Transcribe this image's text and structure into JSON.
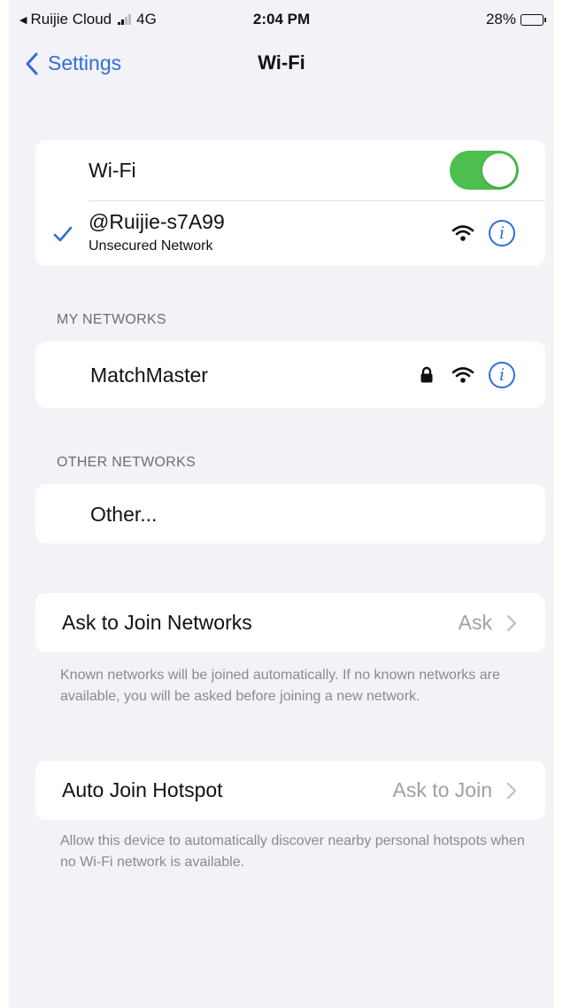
{
  "status_bar": {
    "back_app": "Ruijie Cloud",
    "network_type": "4G",
    "time": "2:04 PM",
    "battery_percent": "28%",
    "battery_level": 0.28,
    "signal_bars": 2
  },
  "nav": {
    "back_label": "Settings",
    "title": "Wi-Fi"
  },
  "wifi_group": {
    "toggle_label": "Wi-Fi",
    "toggle_on": true,
    "connected_network": {
      "name": "@Ruijie-s7A99",
      "status": "Unsecured Network",
      "icons": [
        "checkmark-icon",
        "wifi-icon",
        "info-icon"
      ]
    }
  },
  "my_networks": {
    "header": "MY NETWORKS",
    "items": [
      {
        "name": "MatchMaster",
        "locked": true
      }
    ]
  },
  "other_networks": {
    "header": "OTHER NETWORKS",
    "items": [
      {
        "name": "Other..."
      }
    ]
  },
  "ask_to_join": {
    "label": "Ask to Join Networks",
    "value": "Ask",
    "footer": "Known networks will be joined automatically. If no known networks are available, you will be asked before joining a new network."
  },
  "auto_join_hotspot": {
    "label": "Auto Join Hotspot",
    "value": "Ask to Join",
    "footer": "Allow this device to automatically discover nearby personal hotspots when no Wi-Fi network is available."
  },
  "colors": {
    "accent": "#2f6fd6",
    "toggle_on": "#4cbf4f",
    "background": "#f2f2f7",
    "secondary_text": "#8a8a8e"
  }
}
